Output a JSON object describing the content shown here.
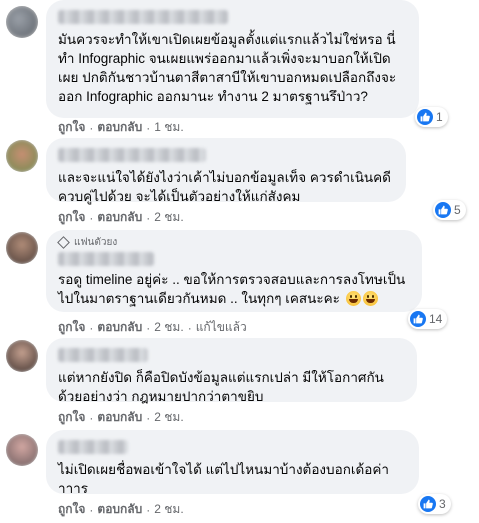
{
  "comments": [
    {
      "text": "มันควรจะทำให้เขาเปิดเผยข้อมูลตั้งแต่แรกแล้วไม่ใช่หรอ นี่ทำ Infographic จนเผยแพร่ออกมาแล้วเพิ่งจะมาบอกให้เปิดเผย ปกติกันชาวบ้านตาสีตาสาบีให้เขาบอกหมดเปลือกถึงจะออก Infographic ออกมานะ ทำงาน 2 มาตรฐานรึป่าว?",
      "like_label": "ถูกใจ",
      "reply_label": "ตอบกลับ",
      "time": "1 ชม.",
      "reaction_count": "1"
    },
    {
      "text": "และจะแน่ใจได้ยังไงว่าเค้าไม่บอกข้อมูลเท็จ ควรดำเนินคดีควบคู่ไปด้วย จะได้เป็นตัวอย่างให้แก่สังคม",
      "like_label": "ถูกใจ",
      "reply_label": "ตอบกลับ",
      "time": "2 ชม.",
      "reaction_count": "5"
    },
    {
      "badge": "แฟนตัวยง",
      "text": "รอดู timeline อยู่ค่ะ .. ขอให้การตรวจสอบและการลงโทษเป็นไปในมาตราฐานเดียวกันหมด .. ในทุกๆ เคสนะคะ",
      "like_label": "ถูกใจ",
      "reply_label": "ตอบกลับ",
      "time": "2 ชม.",
      "edited": "แก้ไขแล้ว",
      "reaction_count": "14"
    },
    {
      "text": "แต่หากยังปิด ก็คือปิดบังข้อมูลแต่แรกเปล่า มีให้โอกาศกันด้วยอย่างว่า กฎหมายปากว่าตาขยิบ",
      "like_label": "ถูกใจ",
      "reply_label": "ตอบกลับ",
      "time": "2 ชม."
    },
    {
      "text": "ไม่เปิดเผยชื่อพอเข้าใจได้ แต่ไปไหนมาบ้างต้องบอกเด้อค่าาาาร",
      "like_label": "ถูกใจ",
      "reply_label": "ตอบกลับ",
      "time": "2 ชม.",
      "reaction_count": "3"
    }
  ],
  "colors": {
    "like_blue": "#1877f2",
    "bubble": "#f0f2f5",
    "meta_gray": "#65676b"
  }
}
